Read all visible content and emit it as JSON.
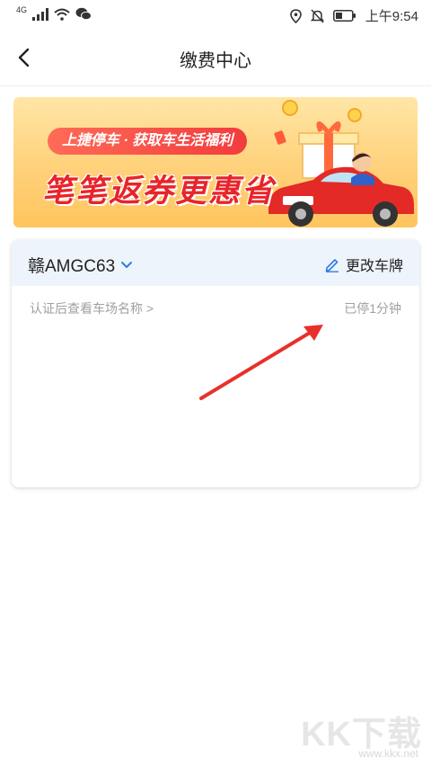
{
  "status_bar": {
    "network": "4G",
    "time": "上午9:54"
  },
  "nav": {
    "title": "缴费中心"
  },
  "banner": {
    "chip_text": "上捷停车 · 获取车生活福利",
    "headline": "笔笔返券更惠省"
  },
  "card": {
    "plate": "赣AMGC63",
    "edit_label": "更改车牌",
    "lot_link": "认证后查看车场名称 >",
    "parked_duration": "已停1分钟"
  },
  "watermark": {
    "logo_text": "KK下载",
    "url": "www.kkx.net"
  },
  "colors": {
    "accent_blue": "#2f7de1",
    "arrow_red": "#e8302a",
    "headline_red": "#e8242a"
  }
}
